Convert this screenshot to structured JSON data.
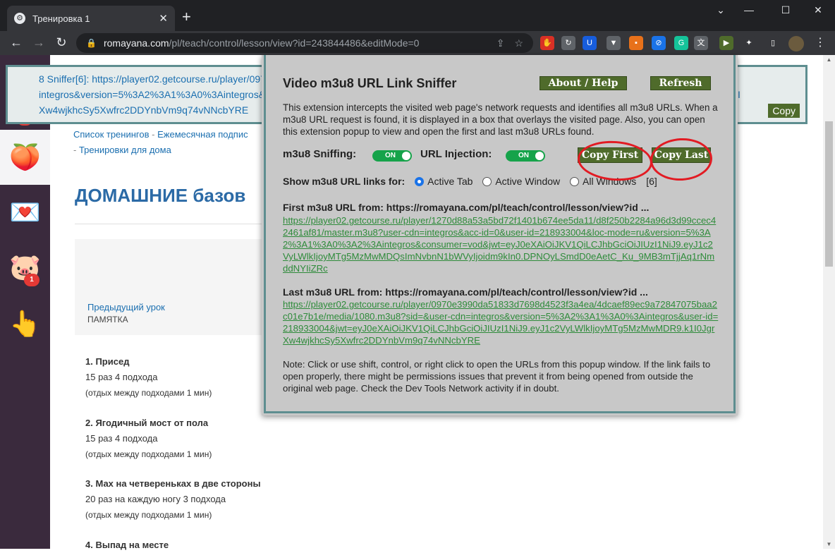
{
  "browser": {
    "tab_title": "Тренировка 1",
    "tab_icon": "⚙",
    "new_tab": "+",
    "url_host": "romayana.com",
    "url_path": "/pl/teach/control/lesson/view?id=243844486&editMode=0",
    "extensions": [
      {
        "name": "stop-extension-icon",
        "color": "#d93025",
        "glyph": "✋"
      },
      {
        "name": "sync-extension-icon",
        "color": "#5f6368",
        "glyph": "↻"
      },
      {
        "name": "bitwarden-extension-icon",
        "color": "#175ddc",
        "glyph": "U"
      },
      {
        "name": "shield-extension-icon",
        "color": "#5f6368",
        "glyph": "▼"
      },
      {
        "name": "save-extension-icon",
        "color": "#e8711a",
        "glyph": "▪"
      },
      {
        "name": "block-extension-icon",
        "color": "#1a73e8",
        "glyph": "⊘"
      },
      {
        "name": "grammarly-extension-icon",
        "color": "#15c39a",
        "glyph": "G"
      },
      {
        "name": "translate-extension-icon",
        "color": "#5f6368",
        "glyph": "文"
      },
      {
        "name": "m3u8-sniffer-extension-icon",
        "color": "#4f6b2b",
        "glyph": "▶"
      },
      {
        "name": "puzzle-extensions-icon",
        "color": "#35363a",
        "glyph": "✦"
      },
      {
        "name": "sidepanel-icon",
        "color": "#35363a",
        "glyph": "▯"
      }
    ]
  },
  "sidebar": {
    "items": [
      {
        "name": "sidebar-item-profile",
        "glyph": "👤",
        "badge": "7"
      },
      {
        "name": "sidebar-item-training",
        "glyph": "🍑",
        "badge": ""
      },
      {
        "name": "sidebar-item-messages",
        "glyph": "💌",
        "badge": ""
      },
      {
        "name": "sidebar-item-sales",
        "glyph": "🐷",
        "badge": "1"
      },
      {
        "name": "sidebar-item-tap",
        "glyph": "👆",
        "badge": ""
      }
    ]
  },
  "overlay": {
    "line1": "8 Sniffer[6]: https://player02.getcourse.ru/player/0970e3990da51833d7698d4523f3a4ea/4dcaef89ec9a72847075baa2c01e7b1e/media/1080.m3u8?sid=&use",
    "line2": "integros&version=5%3A2%3A1%3A0%3Aintegros&user-id=218933004&jwt=eyJ0eXAiOiJKV1QiLCJhbGciOiJIUzI1NiJ9.eyJ1c2VyLWlkIjoyMTg5MzMwMDR9.k1I",
    "line3": "Xw4wjkhcSy5Xwfrc2DDYnbVm9q74vNNcbYRE",
    "copy": "Copy"
  },
  "page": {
    "crumb1": "Список тренингов",
    "crumb_sep": "-",
    "crumb2": "Ежемесячная подпис",
    "crumb3": "Тренировки для дома",
    "title": "ДОМАШНИЕ базов",
    "prev_label": "Предыдущий урок",
    "prev_title": "ПАМЯТКА",
    "exercises": [
      {
        "name": "1. Присед",
        "reps": "15 раз 4 подхода",
        "note": "(отдых между подходами 1 мин)"
      },
      {
        "name": "2. Ягодичный мост от пола",
        "reps": "15 раз 4 подхода",
        "note": "(отдых между подходами 1 мин)"
      },
      {
        "name": "3. Мах на четвереньках в две стороны",
        "reps": "20 раз на каждую ногу 3 подхода",
        "note": "(отдых между подходами 1 мин)"
      },
      {
        "name": "4. Выпад на месте",
        "reps": "",
        "note": ""
      }
    ]
  },
  "popup": {
    "title": "Video m3u8 URL Link Sniffer",
    "about": "About / Help",
    "refresh": "Refresh",
    "description": "This extension intercepts the visited web page's network requests and identifies all m3u8 URLs. When a m3u8 URL request is found, it is displayed in a box that overlays the visited page. Also, you can open this extension popup to view and open the first and last m3u8 URLs found.",
    "sniffing_label": "m3u8 Sniffing:",
    "injection_label": "URL Injection:",
    "toggle_on": "ON",
    "copy_first": "Copy First",
    "copy_last": "Copy Last",
    "show_label": "Show m3u8 URL links for:",
    "opt_active_tab": "Active Tab",
    "opt_active_window": "Active Window",
    "opt_all_windows": "All Windows",
    "count": "[6]",
    "first_head": "First m3u8 URL from:  https://romayana.com/pl/teach/control/lesson/view?id ...",
    "first_url": "https://player02.getcourse.ru/player/1270d88a53a5bd72f1401b674ee5da11/d8f250b2284a96d3d99ccec42461af81/master.m3u8?user-cdn=integros&acc-id=0&user-id=218933004&loc-mode=ru&version=5%3A2%3A1%3A0%3A2%3Aintegros&consumer=vod&jwt=eyJ0eXAiOiJKV1QiLCJhbGciOiJIUzI1NiJ9.eyJ1c2VyLWlkIjoyMTg5MzMwMDQsImNvbnN1bWVyIjoidm9kIn0.DPNOyLSmdD0eAetC_Ku_9MB3mTjjAq1rNmddNYIiZRc",
    "last_head": "Last m3u8 URL from:  https://romayana.com/pl/teach/control/lesson/view?id ...",
    "last_url": "https://player02.getcourse.ru/player/0970e3990da51833d7698d4523f3a4ea/4dcaef89ec9a72847075baa2c01e7b1e/media/1080.m3u8?sid=&user-cdn=integros&version=5%3A2%3A1%3A0%3Aintegros&user-id=218933004&jwt=eyJ0eXAiOiJKV1QiLCJhbGciOiJIUzI1NiJ9.eyJ1c2VyLWlkIjoyMTg5MzMwMDR9.k1I0JgrXw4wjkhcSy5Xwfrc2DDYnbVm9q74vNNcbYRE",
    "note": "Note: Click or use shift, control, or right click to open the URLs from this popup window. If the link fails to open properly, there might be permissions issues that prevent it from being opened from outside the original web page. Check the Dev Tools Network activity if in doubt."
  }
}
